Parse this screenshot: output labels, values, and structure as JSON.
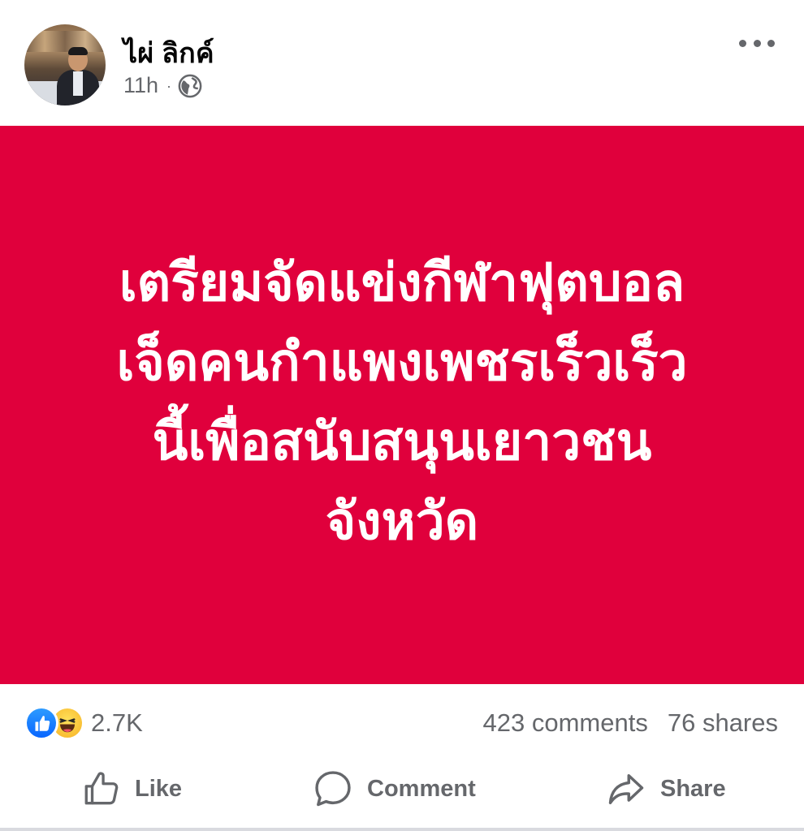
{
  "post": {
    "author": "ไผ่ ลิกค์",
    "time": "11h",
    "separator": "·",
    "audience_icon": "globe-icon",
    "more_icon": "more-horizontal-icon"
  },
  "card": {
    "background": "#e0003c",
    "text_color": "#ffffff",
    "lines": [
      "เตรียมจัดแข่งกีฬาฟุตบอล",
      "เจ็ดคนกำแพงเพชรเร็วเร็ว",
      "นี้เพื่อสนับสนุนเยาวชน",
      "จังหวัด"
    ]
  },
  "reactions": {
    "icons": [
      "like-reaction-icon",
      "haha-reaction-icon"
    ],
    "count": "2.7K",
    "comments": "423 comments",
    "shares": "76 shares"
  },
  "actions": {
    "like": "Like",
    "comment": "Comment",
    "share": "Share"
  },
  "colors": {
    "secondary_text": "#65676b",
    "like_blue": "#0866ff"
  }
}
